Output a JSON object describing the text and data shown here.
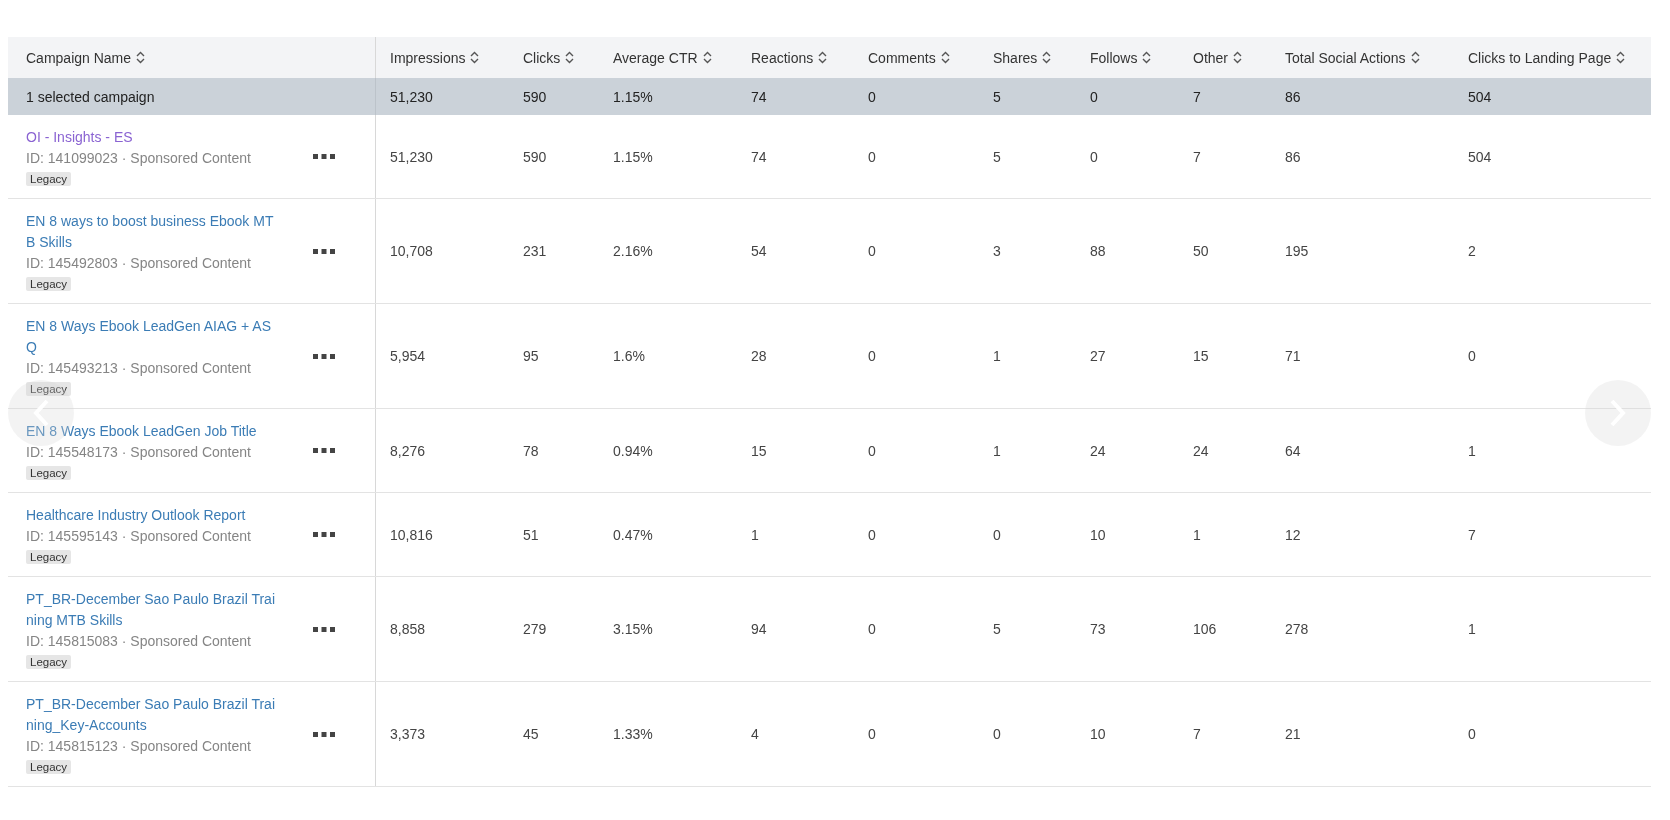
{
  "table": {
    "columns": [
      {
        "label": "Campaign Name"
      },
      {
        "label": "Impressions"
      },
      {
        "label": "Clicks"
      },
      {
        "label": "Average CTR"
      },
      {
        "label": "Reactions"
      },
      {
        "label": "Comments"
      },
      {
        "label": "Shares"
      },
      {
        "label": "Follows"
      },
      {
        "label": "Other"
      },
      {
        "label": "Total Social Actions"
      },
      {
        "label": "Clicks to Landing Page"
      }
    ],
    "summary": {
      "label": "1 selected campaign",
      "values": [
        "51,230",
        "590",
        "1.15%",
        "74",
        "0",
        "5",
        "0",
        "7",
        "86",
        "504"
      ]
    },
    "rows": [
      {
        "name": "OI - Insights - ES",
        "visited": true,
        "meta": "ID: 141099023 · Sponsored Content",
        "badge": "Legacy",
        "values": [
          "51,230",
          "590",
          "1.15%",
          "74",
          "0",
          "5",
          "0",
          "7",
          "86",
          "504"
        ]
      },
      {
        "name": "EN 8 ways to boost business Ebook MTB Skills",
        "visited": false,
        "meta": "ID: 145492803 · Sponsored Content",
        "badge": "Legacy",
        "values": [
          "10,708",
          "231",
          "2.16%",
          "54",
          "0",
          "3",
          "88",
          "50",
          "195",
          "2"
        ]
      },
      {
        "name": "EN 8 Ways Ebook LeadGen AIAG + ASQ",
        "visited": false,
        "meta": "ID: 145493213 · Sponsored Content",
        "badge": "Legacy",
        "values": [
          "5,954",
          "95",
          "1.6%",
          "28",
          "0",
          "1",
          "27",
          "15",
          "71",
          "0"
        ]
      },
      {
        "name": "EN 8 Ways Ebook LeadGen Job Title",
        "visited": false,
        "meta": "ID: 145548173 · Sponsored Content",
        "badge": "Legacy",
        "values": [
          "8,276",
          "78",
          "0.94%",
          "15",
          "0",
          "1",
          "24",
          "24",
          "64",
          "1"
        ]
      },
      {
        "name": "Healthcare Industry Outlook Report",
        "visited": false,
        "meta": "ID: 145595143 · Sponsored Content",
        "badge": "Legacy",
        "values": [
          "10,816",
          "51",
          "0.47%",
          "1",
          "0",
          "0",
          "10",
          "1",
          "12",
          "7"
        ]
      },
      {
        "name": "PT_BR-December Sao Paulo Brazil Training MTB Skills",
        "visited": false,
        "meta": "ID: 145815083 · Sponsored Content",
        "badge": "Legacy",
        "values": [
          "8,858",
          "279",
          "3.15%",
          "94",
          "0",
          "5",
          "73",
          "106",
          "278",
          "1"
        ]
      },
      {
        "name": "PT_BR-December Sao Paulo Brazil Training_Key-Accounts",
        "visited": false,
        "meta": "ID: 145815123 · Sponsored Content",
        "badge": "Legacy",
        "values": [
          "3,373",
          "45",
          "1.33%",
          "4",
          "0",
          "0",
          "10",
          "7",
          "21",
          "0"
        ]
      }
    ]
  }
}
